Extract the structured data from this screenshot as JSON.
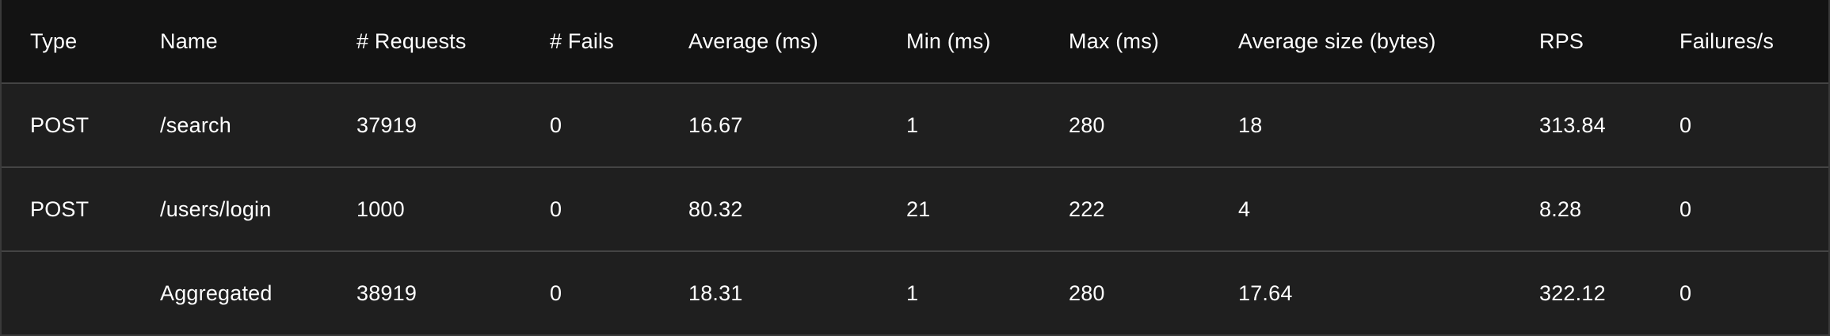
{
  "table": {
    "columns": [
      "Type",
      "Name",
      "# Requests",
      "# Fails",
      "Average (ms)",
      "Min (ms)",
      "Max (ms)",
      "Average size (bytes)",
      "RPS",
      "Failures/s"
    ],
    "rows": [
      {
        "type": "POST",
        "name": "/search",
        "requests": "37919",
        "fails": "0",
        "average_ms": "16.67",
        "min_ms": "1",
        "max_ms": "280",
        "average_size": "18",
        "rps": "313.84",
        "failures_per_s": "0"
      },
      {
        "type": "POST",
        "name": "/users/login",
        "requests": "1000",
        "fails": "0",
        "average_ms": "80.32",
        "min_ms": "21",
        "max_ms": "222",
        "average_size": "4",
        "rps": "8.28",
        "failures_per_s": "0"
      },
      {
        "type": "",
        "name": "Aggregated",
        "requests": "38919",
        "fails": "0",
        "average_ms": "18.31",
        "min_ms": "1",
        "max_ms": "280",
        "average_size": "17.64",
        "rps": "322.12",
        "failures_per_s": "0"
      }
    ]
  }
}
